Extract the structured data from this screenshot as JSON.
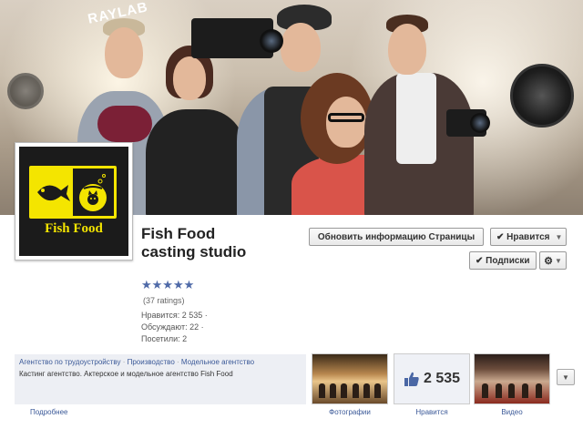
{
  "cover": {
    "brand_text": "RAYLAB"
  },
  "profile": {
    "logo_text": "Fish Food",
    "name": "Fish Food casting studio",
    "stars": "★★★★★",
    "ratings": "(37 ratings)",
    "stats": [
      "Нравится: 2 535 ·",
      "Обсуждают: 22 ·",
      "Посетили: 2"
    ]
  },
  "actions": {
    "update_info": "Обновить информацию Страницы",
    "like": "✔ Нравится",
    "subscriptions": "✔ Подписки"
  },
  "about": {
    "categories": [
      "Агентство по трудоустройству",
      "Производство",
      "Модельное агентство"
    ],
    "description": "Кастинг агентство. Актерское и модельное агентство Fish Food",
    "more": "Подробнее"
  },
  "apps": [
    {
      "label": "Фотографии"
    },
    {
      "label": "Нравится",
      "count": "2 535"
    },
    {
      "label": "Видео"
    }
  ],
  "colors": {
    "link": "#3b5998",
    "logo_yellow": "#f4e500",
    "logo_bg": "#1b1b1b"
  }
}
